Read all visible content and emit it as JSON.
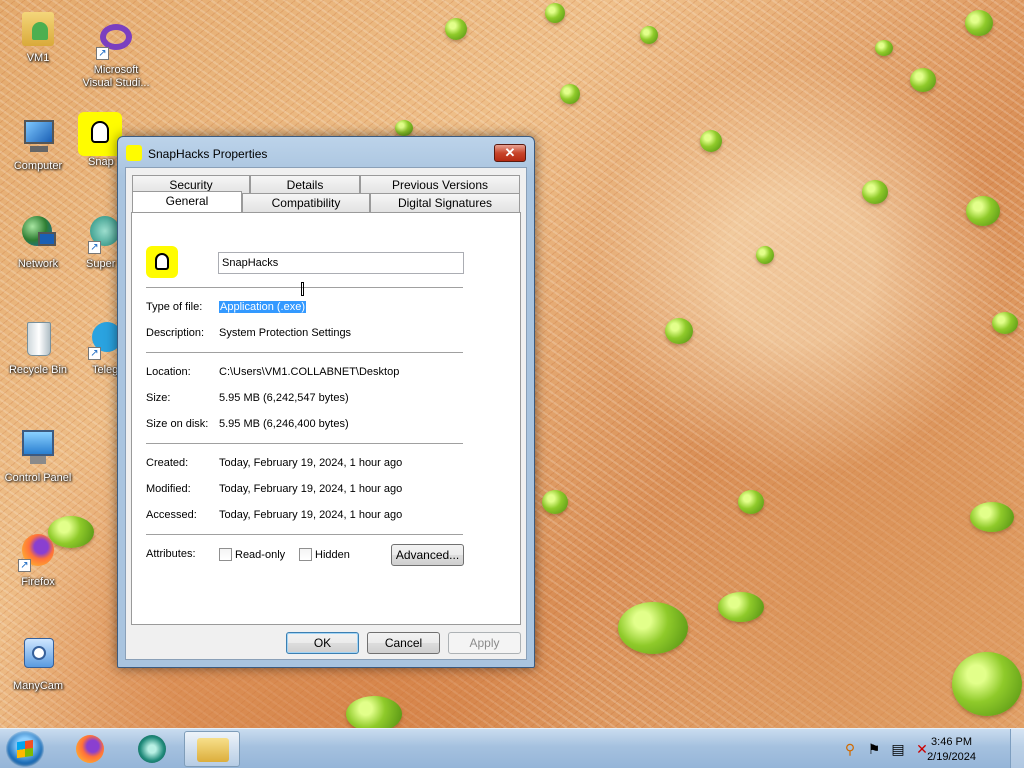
{
  "desktop": {
    "icons": [
      {
        "label": "VM1"
      },
      {
        "label": "Microsoft Visual Studi..."
      },
      {
        "label": "Computer"
      },
      {
        "label": "Snap"
      },
      {
        "label": "Network"
      },
      {
        "label": "Super"
      },
      {
        "label": "Recycle Bin"
      },
      {
        "label": "Teleg"
      },
      {
        "label": "Control Panel"
      },
      {
        "label": "Firefox"
      },
      {
        "label": "ManyCam"
      }
    ]
  },
  "dialog": {
    "title": "SnapHacks Properties",
    "close_label": "✕",
    "tabs_top": [
      "Security",
      "Details",
      "Previous Versions"
    ],
    "tabs_bottom": [
      "General",
      "Compatibility",
      "Digital Signatures"
    ],
    "file_name": "SnapHacks",
    "type_label": "Type of file:",
    "type_value": "Application (.exe)",
    "description_label": "Description:",
    "description_value": "System Protection Settings",
    "location_label": "Location:",
    "location_value": "C:\\Users\\VM1.COLLABNET\\Desktop",
    "size_label": "Size:",
    "size_value": "5.95 MB (6,242,547 bytes)",
    "size_on_disk_label": "Size on disk:",
    "size_on_disk_value": "5.95 MB (6,246,400 bytes)",
    "created_label": "Created:",
    "created_value": "Today, February 19, 2024, 1 hour ago",
    "modified_label": "Modified:",
    "modified_value": "Today, February 19, 2024, 1 hour ago",
    "accessed_label": "Accessed:",
    "accessed_value": "Today, February 19, 2024, 1 hour ago",
    "attributes_label": "Attributes:",
    "readonly_label": "Read-only",
    "hidden_label": "Hidden",
    "advanced_label": "Advanced...",
    "ok_label": "OK",
    "cancel_label": "Cancel",
    "apply_label": "Apply"
  },
  "taskbar": {
    "time": "3:46 PM",
    "date": "2/19/2024"
  }
}
